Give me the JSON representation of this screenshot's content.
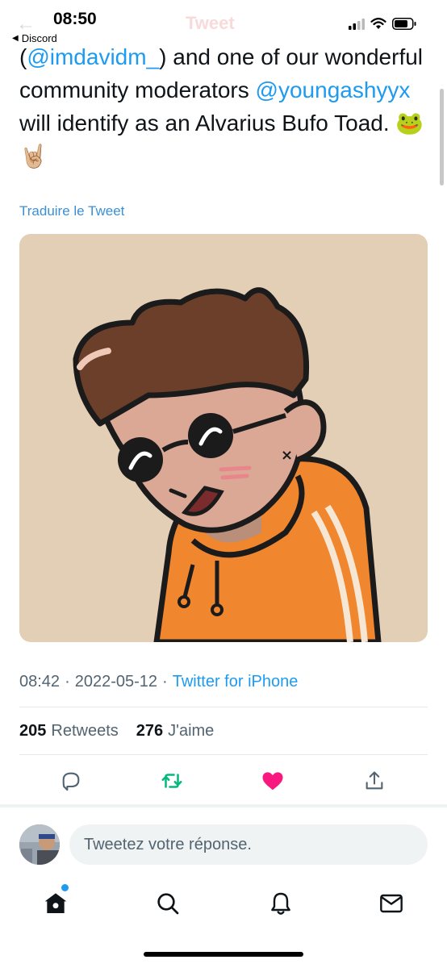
{
  "status_bar": {
    "time": "08:50",
    "back_app": "Discord",
    "icons": [
      "cellular-signal-icon",
      "wifi-icon",
      "battery-icon"
    ]
  },
  "nav": {
    "title": "Tweet"
  },
  "tweet": {
    "text_segments": [
      {
        "text": "(",
        "type": "plain"
      },
      {
        "text": "@imdavidm_",
        "type": "mention"
      },
      {
        "text": ") and one of our wonderful community moderators ",
        "type": "plain"
      },
      {
        "text": "@youngashyyx",
        "type": "mention"
      },
      {
        "text": " will identify as an Alvarius Bufo Toad. 🐸 🤘🏼",
        "type": "plain"
      }
    ],
    "translate_label": "Traduire le Tweet",
    "time": "08:42",
    "date": "2022-05-12",
    "source": "Twitter for iPhone",
    "separator": "·",
    "retweets_count": "205",
    "retweets_label": "Retweets",
    "likes_count": "276",
    "likes_label": "J'aime",
    "liked": true
  },
  "reply": {
    "placeholder": "Tweetez votre réponse."
  },
  "colors": {
    "accent": "#1d9bf0",
    "retweet": "#00ba7c",
    "like": "#f91880",
    "media_bg": "#e2cfb6",
    "hoodie": "#f0862e"
  },
  "tabs": [
    "home-icon",
    "search-icon",
    "notifications-icon",
    "messages-icon"
  ]
}
